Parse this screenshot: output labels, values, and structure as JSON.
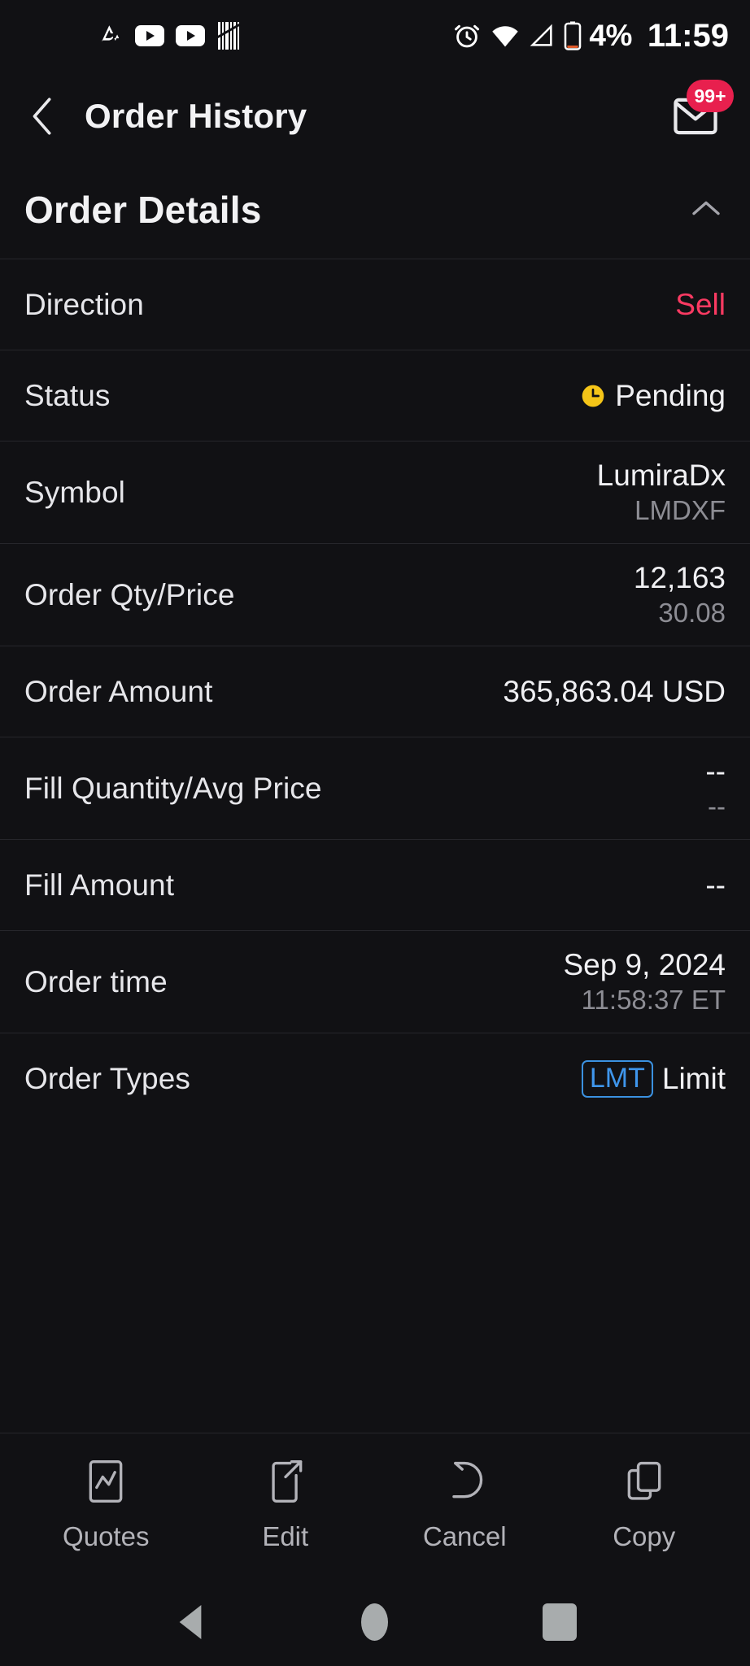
{
  "status_bar": {
    "left_icons": [
      "strava-icon",
      "youtube-icon",
      "youtube-icon",
      "barcode-icon"
    ],
    "alarm_icon": "alarm-icon",
    "wifi_icon": "wifi-icon",
    "signal_icon": "signal-icon",
    "battery_icon": "battery-icon",
    "battery_percent": "4%",
    "clock": "11:59"
  },
  "appbar": {
    "back_icon": "chevron-left-icon",
    "title": "Order History",
    "mail_icon": "mail-icon",
    "mail_badge": "99+"
  },
  "section": {
    "title": "Order Details",
    "collapse_icon": "chevron-up-icon"
  },
  "details": [
    {
      "label": "Direction",
      "value": "Sell",
      "value_style": "sell"
    },
    {
      "label": "Status",
      "value": "Pending",
      "icon": "clock-icon",
      "value_style": "with-icon"
    },
    {
      "label": "Symbol",
      "value": "LumiraDx",
      "sub": "LMDXF"
    },
    {
      "label": "Order Qty/Price",
      "value": "12,163",
      "sub": "30.08"
    },
    {
      "label": "Order Amount",
      "value": "365,863.04 USD"
    },
    {
      "label": "Fill Quantity/Avg Price",
      "value": "--",
      "sub": "--"
    },
    {
      "label": "Fill Amount",
      "value": "--"
    },
    {
      "label": "Order time",
      "value": "Sep 9, 2024",
      "sub": "11:58:37 ET"
    },
    {
      "label": "Order Types",
      "badge": "LMT",
      "value": "Limit",
      "value_style": "badge"
    }
  ],
  "toolbar": [
    {
      "label": "Quotes",
      "icon": "quotes-chart-icon"
    },
    {
      "label": "Edit",
      "icon": "edit-pencil-icon"
    },
    {
      "label": "Cancel",
      "icon": "undo-arrow-icon"
    },
    {
      "label": "Copy",
      "icon": "copy-icon"
    }
  ],
  "navbar": {
    "back": "android-back-icon",
    "home": "android-home-icon",
    "recents": "android-recents-icon"
  },
  "colors": {
    "background": "#111114",
    "sell": "#fa3a62",
    "pending": "#f5c518",
    "badge_blue": "#3f96ec",
    "notification_red": "#e8204e",
    "text_primary": "#f0f0f3",
    "text_secondary": "#8d8d94",
    "divider": "#26262b"
  }
}
